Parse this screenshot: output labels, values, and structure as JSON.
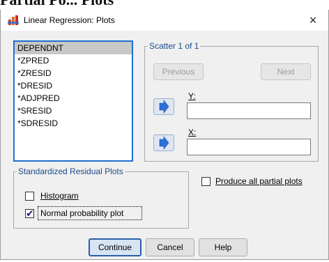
{
  "background_text": "Partial Po... Plots",
  "window": {
    "title": "Linear Regression: Plots",
    "close_glyph": "×"
  },
  "variables": [
    "DEPENDNT",
    "*ZPRED",
    "*ZRESID",
    "*DRESID",
    "*ADJPRED",
    "*SRESID",
    "*SDRESID"
  ],
  "scatter": {
    "legend": "Scatter 1 of 1",
    "previous_label": "Previous",
    "next_label": "Next",
    "y_label": "Y:",
    "x_label": "X:",
    "y_value": "",
    "x_value": ""
  },
  "residual_plots": {
    "legend": "Standardized Residual Plots",
    "histogram_label": "Histogram",
    "histogram_checked": false,
    "normal_prob_label": "Normal probability plot",
    "normal_prob_checked": true
  },
  "partial": {
    "label": "Produce all partial plots",
    "checked": false
  },
  "buttons": {
    "continue": "Continue",
    "cancel": "Cancel",
    "help": "Help"
  },
  "colors": {
    "accent": "#1f6fcf",
    "arrow": "#2f6fd8"
  },
  "icons": {
    "app": "spss-app-icon",
    "arrow": "right-arrow-icon",
    "close": "close-icon"
  }
}
